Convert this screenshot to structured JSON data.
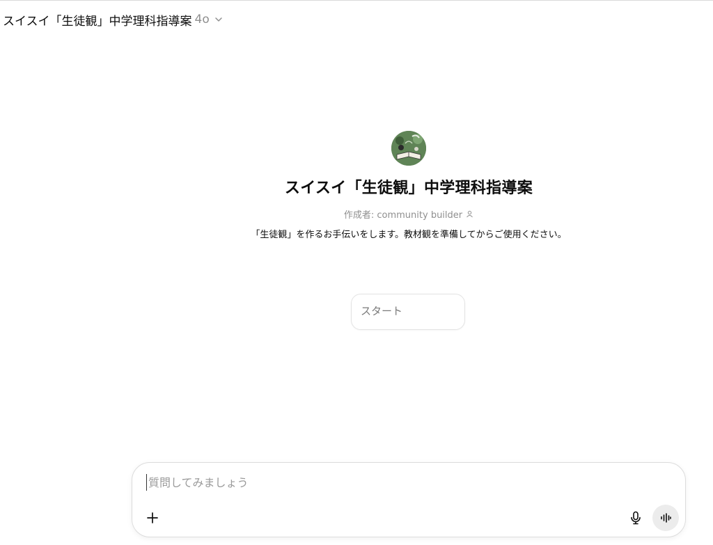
{
  "header": {
    "title": "スイスイ「生徒観」中学理科指導案",
    "model": "4o",
    "model_chevron_icon": "chevron-down-icon"
  },
  "profile": {
    "avatar_icon": "gpt-avatar-image",
    "name": "スイスイ「生徒観」中学理科指導案",
    "author_label": "作成者: community builder",
    "author_icon": "person-icon",
    "description": "「生徒観」を作るお手伝いをします。教材観を準備してからご使用ください。"
  },
  "starters": [
    {
      "label": "スタート"
    }
  ],
  "composer": {
    "placeholder": "質問してみましょう",
    "value": "",
    "plus_icon": "plus-icon",
    "mic_icon": "microphone-icon",
    "voice_icon": "voice-waveform-icon"
  },
  "colors": {
    "text_primary": "#0d0d0d",
    "text_secondary": "#8f8f8f",
    "border": "#dcdcdc",
    "voice_button_bg": "#ececec",
    "avatar_green": "#5f8456"
  }
}
